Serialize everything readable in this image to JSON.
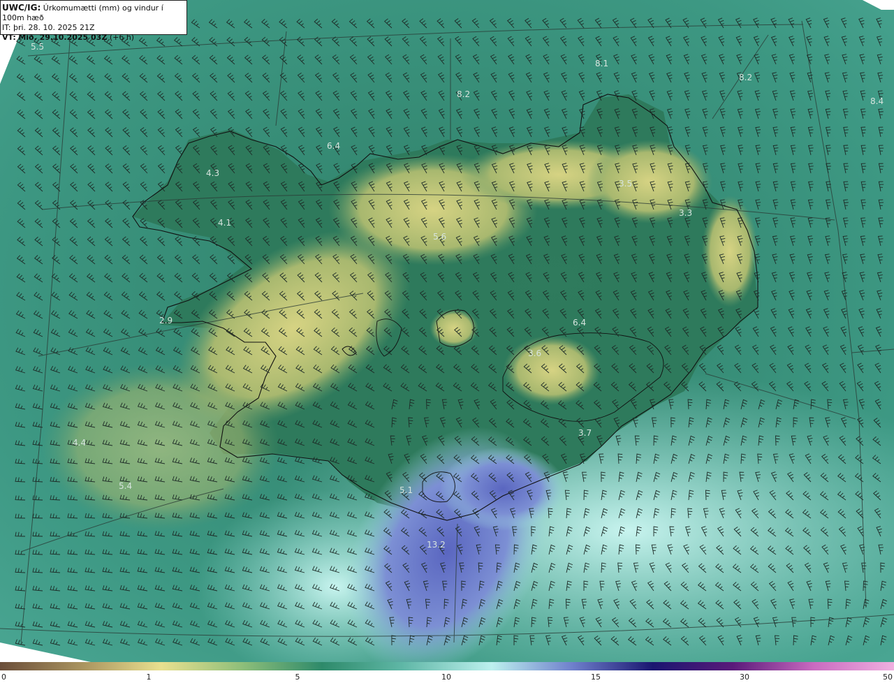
{
  "header": {
    "model": "UWC/IG:",
    "title": "Úrkomumætti (mm) og vindur í 100m hæð",
    "it_label": "IT:",
    "it_value": "þri. 28. 10. 2025 21Z",
    "vt_label": "VT:",
    "vt_value": "Mið. 29.10.2025 03Z",
    "vt_offset": "(+6 h)"
  },
  "map_labels": [
    {
      "id": "a",
      "text": "5.5"
    },
    {
      "id": "b",
      "text": "8.1"
    },
    {
      "id": "c",
      "text": "8.2"
    },
    {
      "id": "d",
      "text": "6.4"
    },
    {
      "id": "e",
      "text": "8.2"
    },
    {
      "id": "f",
      "text": "8.4"
    },
    {
      "id": "g",
      "text": "4.3"
    },
    {
      "id": "h",
      "text": "3.5"
    },
    {
      "id": "i",
      "text": "3.3"
    },
    {
      "id": "j",
      "text": "4.1"
    },
    {
      "id": "k",
      "text": "5.6"
    },
    {
      "id": "l",
      "text": "2.9"
    },
    {
      "id": "m",
      "text": "6.4"
    },
    {
      "id": "n",
      "text": "3.6"
    },
    {
      "id": "o",
      "text": "3.7"
    },
    {
      "id": "p",
      "text": "4.4"
    },
    {
      "id": "q",
      "text": "5.4"
    },
    {
      "id": "r",
      "text": "5.1"
    },
    {
      "id": "s",
      "text": "13.2"
    }
  ],
  "colorbar": {
    "ticks": [
      "0",
      "1",
      "5",
      "10",
      "15",
      "30",
      "50"
    ],
    "colors": [
      "#6b4e3a",
      "#a8925e",
      "#e9e08f",
      "#8fbf7a",
      "#2e8a6a",
      "#5fb7a6",
      "#bdf0ee",
      "#6f80cc",
      "#1a1670",
      "#5a1a7a",
      "#c96ac0",
      "#f0b0e0"
    ]
  },
  "colors": {
    "sea": "#3f9a86",
    "land_low": "#2f7a5e",
    "land_high": "#c9c87a",
    "heavy": "#6f7cc8",
    "light_sea": "#a7e3dc",
    "barb": "#1d2a26",
    "coast": "#111111"
  }
}
